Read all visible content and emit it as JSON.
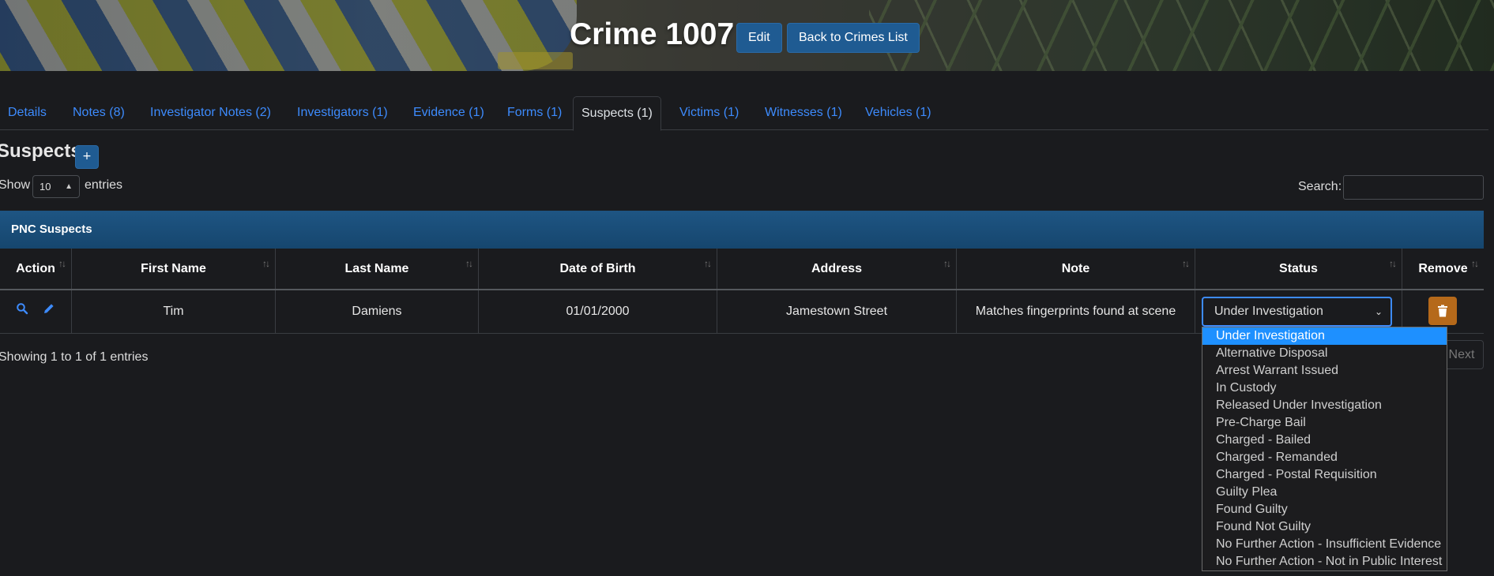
{
  "header": {
    "title": "Crime 1007",
    "edit_label": "Edit",
    "back_label": "Back to Crimes List"
  },
  "tabs": [
    {
      "label": "Details"
    },
    {
      "label": "Notes (8)"
    },
    {
      "label": "Investigator Notes (2)"
    },
    {
      "label": "Investigators (1)"
    },
    {
      "label": "Evidence (1)"
    },
    {
      "label": "Forms (1)"
    },
    {
      "label": "Suspects (1)",
      "active": true
    },
    {
      "label": "Victims (1)"
    },
    {
      "label": "Witnesses (1)"
    },
    {
      "label": "Vehicles (1)"
    }
  ],
  "section": {
    "title": "Suspects",
    "add_label": "+"
  },
  "table_controls": {
    "show_label": "Show",
    "page_length": "10",
    "entries_label": "entries",
    "search_label": "Search:",
    "search_value": ""
  },
  "table": {
    "caption": "PNC Suspects",
    "columns": [
      "Action",
      "First Name",
      "Last Name",
      "Date of Birth",
      "Address",
      "Note",
      "Status",
      "Remove"
    ],
    "rows": [
      {
        "first_name": "Tim",
        "last_name": "Damiens",
        "dob": "01/01/2000",
        "address": "Jamestown Street",
        "note": "Matches fingerprints found at scene",
        "status": "Under Investigation"
      }
    ],
    "info": "Showing 1 to 1 of 1 entries",
    "next_label": "Next"
  },
  "status_options": [
    "Under Investigation",
    "Alternative Disposal",
    "Arrest Warrant Issued",
    "In Custody",
    "Released Under Investigation",
    "Pre-Charge Bail",
    "Charged - Bailed",
    "Charged - Remanded",
    "Charged - Postal Requisition",
    "Guilty Plea",
    "Found Guilty",
    "Found Not Guilty",
    "No Further Action - Insufficient Evidence",
    "No Further Action - Not in Public Interest"
  ],
  "icons": {
    "view": "magnifier-icon",
    "edit": "pencil-icon",
    "remove": "trash-icon",
    "sort": "sort-arrows-icon"
  },
  "colors": {
    "background": "#1a1b1e",
    "link": "#3d8bfd",
    "primary_button": "#1f5b92",
    "caption_bar": "#1e5583",
    "danger_button": "#b5691a",
    "dropdown_selected": "#1e90ff"
  }
}
